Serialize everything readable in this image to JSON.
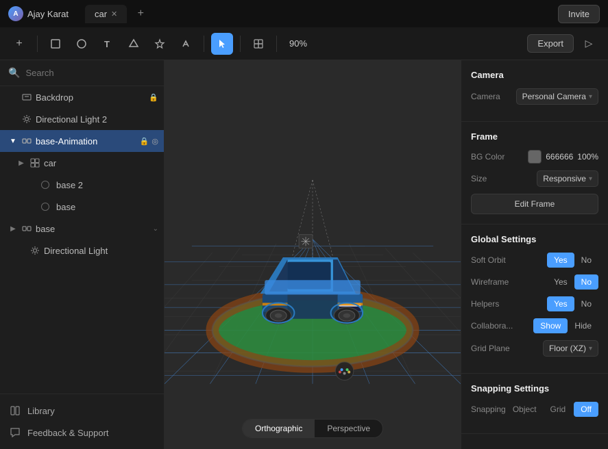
{
  "titlebar": {
    "user": "Ajay Karat",
    "tab_label": "car",
    "invite_label": "Invite"
  },
  "toolbar": {
    "zoom": "90%",
    "export_label": "Export",
    "add_label": "+",
    "tools": [
      "add",
      "rectangle",
      "circle",
      "text",
      "polygon",
      "star",
      "arrow",
      "select",
      "component",
      "mask"
    ]
  },
  "sidebar": {
    "search_placeholder": "Search",
    "items": [
      {
        "id": "backdrop",
        "label": "Backdrop",
        "indent": 0,
        "icon": "backdrop",
        "has_lock": true
      },
      {
        "id": "directional-light-2",
        "label": "Directional Light 2",
        "indent": 0,
        "icon": "light"
      },
      {
        "id": "base-animation",
        "label": "base-Animation",
        "indent": 0,
        "icon": "group",
        "expanded": true,
        "selected": true
      },
      {
        "id": "car",
        "label": "car",
        "indent": 1,
        "icon": "component",
        "expanded": true
      },
      {
        "id": "base-2",
        "label": "base 2",
        "indent": 2,
        "icon": "circle"
      },
      {
        "id": "base",
        "label": "base",
        "indent": 2,
        "icon": "circle"
      },
      {
        "id": "base-group",
        "label": "base",
        "indent": 0,
        "icon": "group",
        "expanded": false
      },
      {
        "id": "directional-light",
        "label": "Directional Light",
        "indent": 1,
        "icon": "light"
      }
    ],
    "library_label": "Library",
    "feedback_label": "Feedback & Support"
  },
  "viewport": {
    "view_toggle": {
      "orthographic": "Orthographic",
      "perspective": "Perspective",
      "active": "orthographic"
    }
  },
  "right_panel": {
    "camera_section": {
      "title": "Camera",
      "camera_label": "Camera",
      "camera_value": "Personal Camera"
    },
    "frame_section": {
      "title": "Frame",
      "bg_color_label": "BG Color",
      "bg_color_hex": "666666",
      "bg_color_opacity": "100%",
      "size_label": "Size",
      "size_value": "Responsive",
      "edit_frame_label": "Edit Frame"
    },
    "global_settings": {
      "title": "Global Settings",
      "soft_orbit_label": "Soft Orbit",
      "soft_orbit_yes": "Yes",
      "soft_orbit_no": "No",
      "soft_orbit_active": "yes",
      "wireframe_label": "Wireframe",
      "wireframe_yes": "Yes",
      "wireframe_no": "No",
      "wireframe_active": "no",
      "helpers_label": "Helpers",
      "helpers_yes": "Yes",
      "helpers_no": "No",
      "helpers_active": "yes",
      "collabora_label": "Collabora...",
      "collabora_show": "Show",
      "collabora_hide": "Hide",
      "collabora_active": "show",
      "grid_plane_label": "Grid Plane",
      "grid_plane_value": "Floor (XZ)"
    },
    "snapping_settings": {
      "title": "Snapping Settings",
      "snapping_label": "Snapping",
      "object_label": "Object",
      "grid_label": "Grid",
      "off_label": "Off",
      "active": "off"
    }
  }
}
